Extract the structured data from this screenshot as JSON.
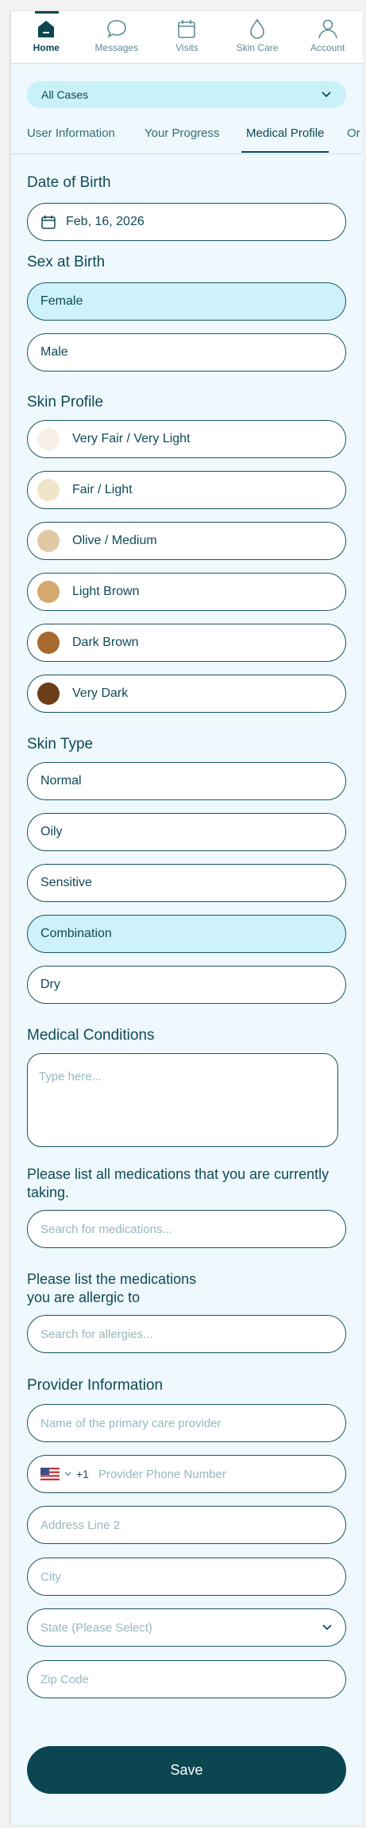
{
  "nav": {
    "items": [
      {
        "label": "Home",
        "icon": "home-icon",
        "active": true
      },
      {
        "label": "Messages",
        "icon": "chat-bubble-icon",
        "active": false
      },
      {
        "label": "Visits",
        "icon": "calendar-icon",
        "active": false
      },
      {
        "label": "Skin Care",
        "icon": "droplet-icon",
        "active": false
      },
      {
        "label": "Account",
        "icon": "person-icon",
        "active": false
      }
    ]
  },
  "case_select": {
    "value": "All Cases"
  },
  "tabs": [
    {
      "label": "User Information",
      "active": false
    },
    {
      "label": "Your Progress",
      "active": false
    },
    {
      "label": "Medical Profile",
      "active": true
    },
    {
      "label": "Or",
      "active": false
    }
  ],
  "dob": {
    "title": "Date of Birth",
    "value": "Feb, 16, 2026"
  },
  "sex": {
    "title": "Sex at Birth",
    "options": [
      {
        "label": "Female",
        "selected": true
      },
      {
        "label": "Male",
        "selected": false
      }
    ]
  },
  "skin_profile": {
    "title": "Skin Profile",
    "options": [
      {
        "label": "Very Fair / Very Light",
        "color": "#f6efe6"
      },
      {
        "label": "Fair / Light",
        "color": "#f0e4c9"
      },
      {
        "label": "Olive / Medium",
        "color": "#e0c9a5"
      },
      {
        "label": "Light Brown",
        "color": "#d4a86e"
      },
      {
        "label": "Dark Brown",
        "color": "#a7692d"
      },
      {
        "label": "Very Dark",
        "color": "#6b3e17"
      }
    ]
  },
  "skin_type": {
    "title": "Skin Type",
    "options": [
      {
        "label": "Normal",
        "selected": false
      },
      {
        "label": "Oily",
        "selected": false
      },
      {
        "label": "Sensitive",
        "selected": false
      },
      {
        "label": "Combination",
        "selected": true
      },
      {
        "label": "Dry",
        "selected": false
      }
    ]
  },
  "medical_conditions": {
    "title": "Medical Conditions",
    "placeholder": "Type here..."
  },
  "medications": {
    "title": "Please list all medications that you are currently taking.",
    "placeholder": "Search for medications..."
  },
  "allergies": {
    "title_line1": "Please list the medications",
    "title_line2": "you are allergic to",
    "placeholder": "Search for allergies..."
  },
  "provider": {
    "title": "Provider Information",
    "name_placeholder": "Name of the primary care provider",
    "phone_code": "+1",
    "phone_placeholder": "Provider Phone Number",
    "address_placeholder": "Address Line 2",
    "city_placeholder": "City",
    "state_placeholder": "State (Please Select)",
    "zip_placeholder": "Zip Code"
  },
  "save_label": "Save",
  "colors": {
    "primary": "#0b4651",
    "selected_bg": "#cdf2fa",
    "page_bg": "#eef8fd"
  }
}
